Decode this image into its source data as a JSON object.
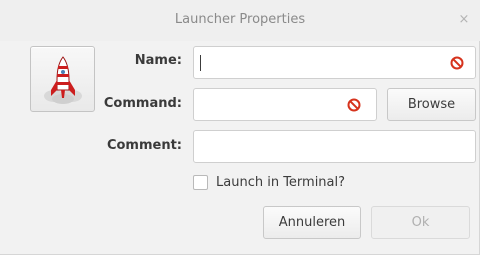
{
  "window": {
    "title": "Launcher Properties",
    "close_glyph": "×"
  },
  "icon": {
    "name": "rocket-icon"
  },
  "form": {
    "name_label": "Name:",
    "name_value": "",
    "command_label": "Command:",
    "command_value": "",
    "comment_label": "Comment:",
    "comment_value": "",
    "terminal_label": "Launch in Terminal?",
    "terminal_checked": false
  },
  "buttons": {
    "browse": "Browse",
    "cancel": "Annuleren",
    "ok": "Ok"
  },
  "colors": {
    "warning": "#d6331d"
  }
}
